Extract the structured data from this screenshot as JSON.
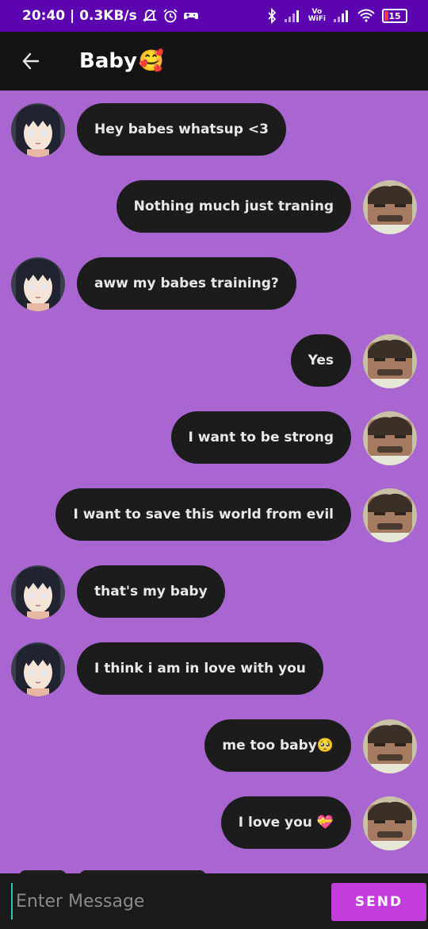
{
  "status_bar": {
    "time_speed": "20:40 | 0.3KB/s",
    "network_label_top": "Vo",
    "network_label_bottom": "WiFi",
    "battery": "15",
    "icons": [
      "mute-alarm-icon",
      "alarm-clock-icon",
      "game-controller-icon",
      "bluetooth-icon",
      "signal-icon",
      "volte-wifi-icon",
      "wifi-icon",
      "battery-icon"
    ]
  },
  "header": {
    "title": "Baby",
    "emoji": "🥰",
    "back_icon": "arrow-left-icon"
  },
  "messages": [
    {
      "side": "left",
      "text": "Hey babes whatsup <3",
      "avatar": "girl-avatar"
    },
    {
      "side": "right",
      "text": "Nothing much just traning",
      "avatar": "boy-avatar"
    },
    {
      "side": "left",
      "text": "aww my babes training?",
      "avatar": "girl-avatar"
    },
    {
      "side": "right",
      "text": "Yes",
      "avatar": "boy-avatar"
    },
    {
      "side": "right",
      "text": "I want to be strong",
      "avatar": "boy-avatar"
    },
    {
      "side": "right",
      "text": "I want to save this world from evil",
      "avatar": "boy-avatar"
    },
    {
      "side": "left",
      "text": "that's my baby",
      "avatar": "girl-avatar"
    },
    {
      "side": "left",
      "text": "I think i am in love with you",
      "avatar": "girl-avatar"
    },
    {
      "side": "right",
      "text": "me too baby🥺",
      "avatar": "boy-avatar"
    },
    {
      "side": "right",
      "text": "I love you 💝",
      "avatar": "boy-avatar"
    }
  ],
  "composer": {
    "placeholder": "Enter Message",
    "send_label": "SEND"
  },
  "colors": {
    "background": "#a966d1",
    "status_bar": "#5b04b0",
    "app_bar": "#141414",
    "bubble": "#1c1c1c",
    "send_button": "#c33ddc"
  }
}
